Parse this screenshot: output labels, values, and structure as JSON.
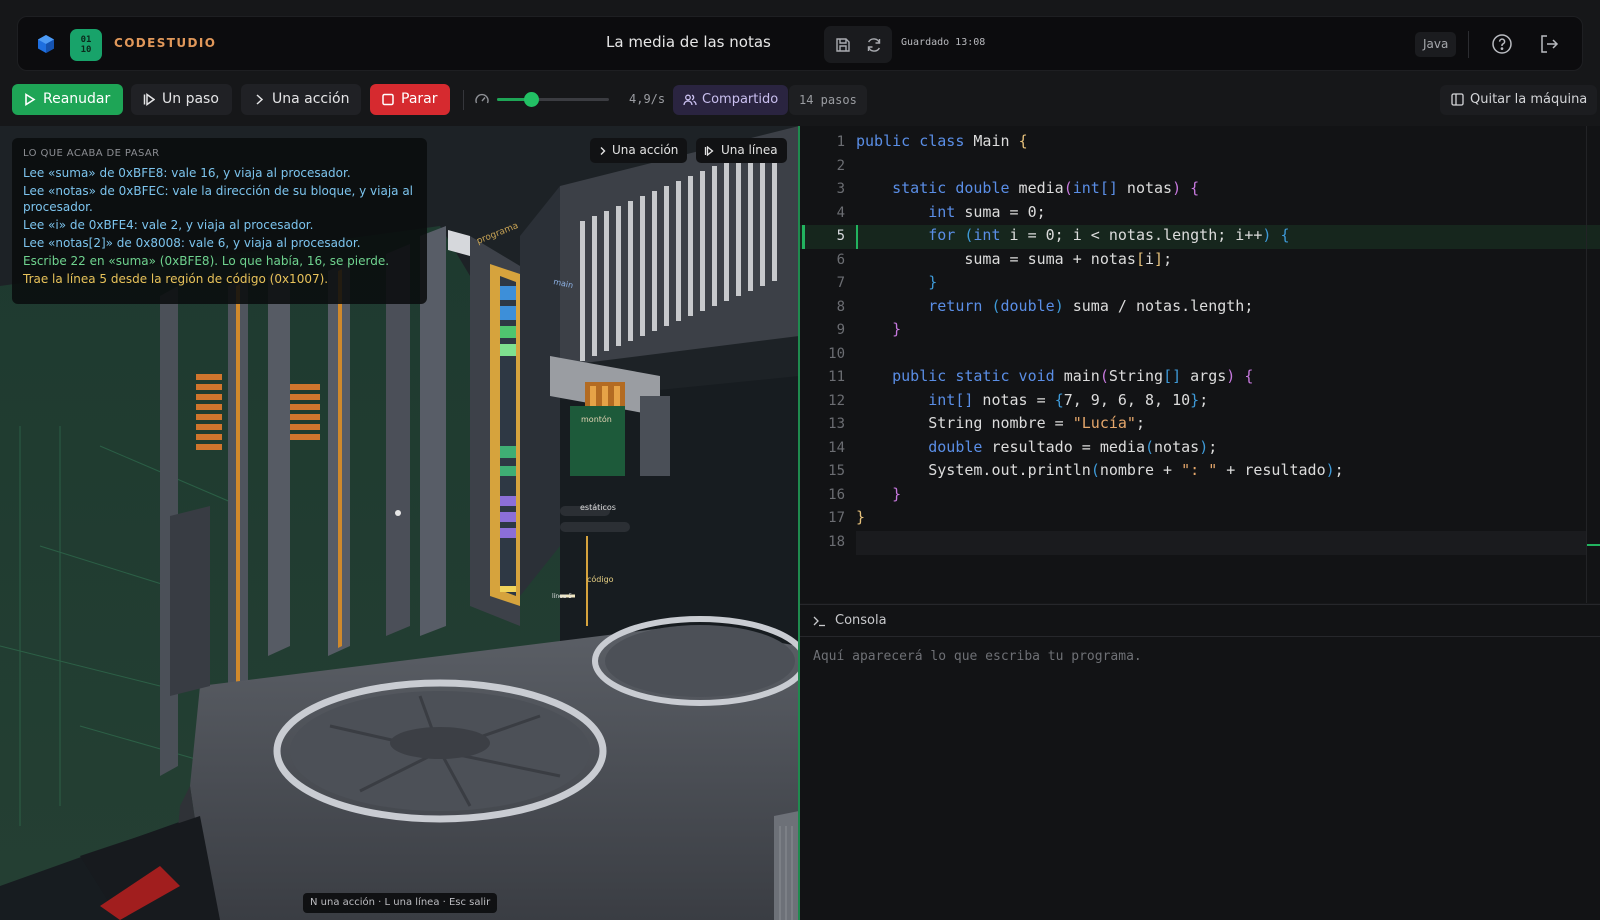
{
  "header": {
    "brand": "CODESTUDIO",
    "brand_logo_text": "01\n10",
    "title": "La media de las notas",
    "saved_label": "Guardado 13:08",
    "language": "Java"
  },
  "toolbar": {
    "resume_label": "Reanudar",
    "step_label": "Un paso",
    "action_label": "Una acción",
    "stop_label": "Parar",
    "speed_value": "4,9/s",
    "speed_level": 0.3,
    "shared_label": "Compartido",
    "steps_label": "14 pasos",
    "remove_machine_label": "Quitar la máquina"
  },
  "scene": {
    "log_title": "LO QUE ACABA DE PASAR",
    "log_lines": [
      {
        "text": "Lee «suma» de 0xBFE8: vale 16, y viaja al procesador.",
        "color": "#7cc4ee"
      },
      {
        "text": "Lee «notas» de 0xBFEC: vale la dirección de su bloque, y viaja al procesador.",
        "color": "#7cc4ee"
      },
      {
        "text": "Lee «i» de 0xBFE4: vale 2, y viaja al procesador.",
        "color": "#7cc4ee"
      },
      {
        "text": "Lee «notas[2]» de 0x8008: vale 6, y viaja al procesador.",
        "color": "#7cc4ee"
      },
      {
        "text": "Escribe 22 en «suma» (0xBFE8). Lo que había, 16, se pierde.",
        "color": "#6fd38f"
      },
      {
        "text": "Trae la línea 5 desde la región de código (0x1007).",
        "color": "#e8c25a"
      }
    ],
    "btn_action_label": "Una acción",
    "btn_line_label": "Una línea",
    "shortcut_hint": "N una acción · L una línea · Esc salir",
    "labels": {
      "programa": "programa",
      "main": "main",
      "monton": "montón",
      "estaticos": "estáticos",
      "codigo": "código",
      "linea": "línea 5"
    }
  },
  "editor": {
    "active_line": 5,
    "lines": [
      {
        "n": "1",
        "html": "<span class='kw'>public class</span> Main <span class='br1'>{</span>"
      },
      {
        "n": "2",
        "html": ""
      },
      {
        "n": "3",
        "html": "    <span class='kw'>static double</span> media<span class='br2'>(</span><span class='ty'>int[]</span> notas<span class='br2'>)</span> <span class='br2'>{</span>"
      },
      {
        "n": "4",
        "html": "        <span class='ty'>int</span> suma = 0;"
      },
      {
        "n": "5",
        "html": "        <span class='kw'>for</span> <span class='br3'>(</span><span class='ty'>int</span> i = 0; i &lt; notas.length; i++<span class='br3'>)</span> <span class='br3'>{</span>"
      },
      {
        "n": "6",
        "html": "            suma = suma + notas<span class='br1'>[</span>i<span class='br1'>]</span>;"
      },
      {
        "n": "7",
        "html": "        <span class='br3'>}</span>"
      },
      {
        "n": "8",
        "html": "        <span class='kw'>return</span> <span class='br3'>(</span><span class='ty'>double</span><span class='br3'>)</span> suma / notas.length;"
      },
      {
        "n": "9",
        "html": "    <span class='br2'>}</span>"
      },
      {
        "n": "10",
        "html": ""
      },
      {
        "n": "11",
        "html": "    <span class='kw'>public static void</span> main<span class='br2'>(</span>String<span class='br3'>[]</span> args<span class='br2'>)</span> <span class='br2'>{</span>"
      },
      {
        "n": "12",
        "html": "        <span class='ty'>int[]</span> notas = <span class='br3'>{</span>7, 9, 6, 8, 10<span class='br3'>}</span>;"
      },
      {
        "n": "13",
        "html": "        String nombre = <span class='st'>\"Lucía\"</span>;"
      },
      {
        "n": "14",
        "html": "        <span class='ty'>double</span> resultado = media<span class='br3'>(</span>notas<span class='br3'>)</span>;"
      },
      {
        "n": "15",
        "html": "        System.out.println<span class='br3'>(</span>nombre + <span class='st'>\": \"</span> + resultado<span class='br3'>)</span>;"
      },
      {
        "n": "16",
        "html": "    <span class='br2'>}</span>"
      },
      {
        "n": "17",
        "html": "<span class='br1'>}</span>"
      },
      {
        "n": "18",
        "html": ""
      }
    ]
  },
  "console": {
    "title": "Consola",
    "placeholder": "Aquí aparecerá lo que escriba tu programa."
  },
  "colors": {
    "accent_green": "#1ea556",
    "stop_red": "#d62a2f",
    "brand_orange": "#e1985a"
  }
}
